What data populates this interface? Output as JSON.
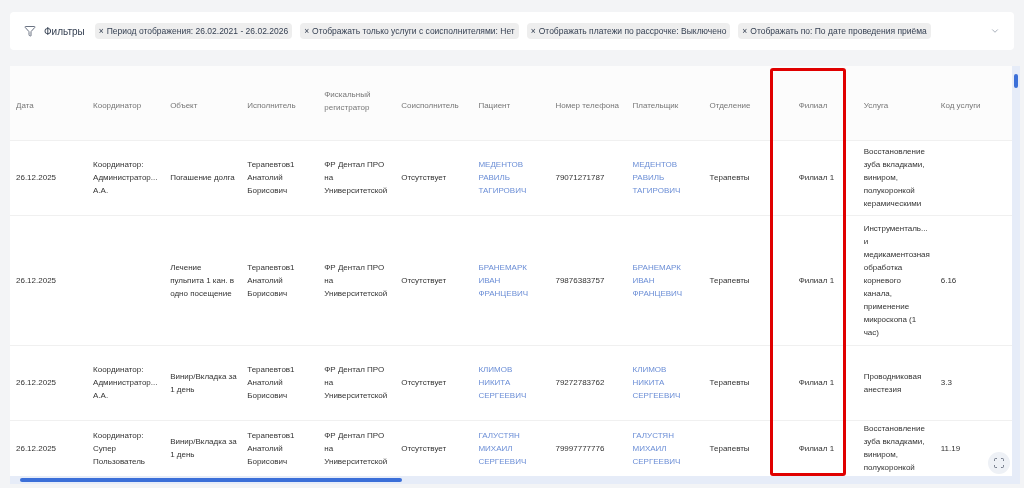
{
  "filters": {
    "label": "Фильтры",
    "tags": [
      {
        "remove": "×",
        "text": "Период отображения: 26.02.2021 - 26.02.2026"
      },
      {
        "remove": "×",
        "text": "Отображать только услуги с соисполнителями: Нет"
      },
      {
        "remove": "×",
        "text": "Отображать платежи по рассрочке: Выключено"
      },
      {
        "remove": "×",
        "text": "Отображать по: По дате проведения приёма"
      }
    ]
  },
  "table": {
    "columns": [
      {
        "label": "Дата",
        "kind": "text",
        "highlighted": false
      },
      {
        "label": "Координатор",
        "kind": "text",
        "highlighted": false
      },
      {
        "label": "Объект",
        "kind": "text",
        "highlighted": false
      },
      {
        "label": "Исполнитель",
        "kind": "text",
        "highlighted": false
      },
      {
        "label": "Фискальный регистратор",
        "kind": "text",
        "highlighted": false
      },
      {
        "label": "Соисполнитель",
        "kind": "text",
        "highlighted": false
      },
      {
        "label": "Пациент",
        "kind": "link",
        "highlighted": false
      },
      {
        "label": "Номер телефона",
        "kind": "text",
        "highlighted": false
      },
      {
        "label": "Плательщик",
        "kind": "link",
        "highlighted": false
      },
      {
        "label": "Отделение",
        "kind": "text",
        "highlighted": false
      },
      {
        "label": "Филиал",
        "kind": "text",
        "highlighted": true
      },
      {
        "label": "Услуга",
        "kind": "text",
        "highlighted": false
      },
      {
        "label": "Код услуги",
        "kind": "text",
        "highlighted": false
      }
    ],
    "rows": [
      {
        "cells": [
          "26.12.2025",
          "Координатор: Администратор... А.А.",
          "Погашение долга",
          "Терапевтов1 Анатолий Борисович",
          "ФР Дентал ПРО на Университетской",
          "Отсутствует",
          "МЕДЕНТОВ РАВИЛЬ ТАГИРОВИЧ",
          "79071271787",
          "МЕДЕНТОВ РАВИЛЬ ТАГИРОВИЧ",
          "Терапевты",
          "Филиал 1",
          "Восстановление зуба вкладками, виниром, полукоронкой керамическими",
          ""
        ]
      },
      {
        "cells": [
          "26.12.2025",
          "",
          "Лечение пульпита 1 кан. в одно посещение",
          "Терапевтов1 Анатолий Борисович",
          "ФР Дентал ПРО на Университетской",
          "Отсутствует",
          "БРАНЕМАРК ИВАН ФРАНЦЕВИЧ",
          "79876383757",
          "БРАНЕМАРК ИВАН ФРАНЦЕВИЧ",
          "Терапевты",
          "Филиал 1",
          "Инструменталь... и медикаментозная обработка корневого канала, применение микроскопа (1 час)",
          "6.16"
        ]
      },
      {
        "cells": [
          "26.12.2025",
          "Координатор: Администратор... А.А.",
          "Винир/Вкладка за 1 день",
          "Терапевтов1 Анатолий Борисович",
          "ФР Дентал ПРО на Университетской",
          "Отсутствует",
          "КЛИМОВ НИКИТА СЕРГЕЕВИЧ",
          "79272783762",
          "КЛИМОВ НИКИТА СЕРГЕЕВИЧ",
          "Терапевты",
          "Филиал 1",
          "Проводниковая анестезия",
          "3.3"
        ]
      },
      {
        "cells": [
          "26.12.2025",
          "Координатор: Супер Пользователь",
          "Винир/Вкладка за 1 день",
          "Терапевтов1 Анатолий Борисович",
          "ФР Дентал ПРО на Университетской",
          "Отсутствует",
          "ГАЛУСТЯН МИХАИЛ СЕРГЕЕВИЧ",
          "79997777776",
          "ГАЛУСТЯН МИХАИЛ СЕРГЕЕВИЧ",
          "Терапевты",
          "Филиал 1",
          "Восстановление зуба вкладками, виниром, полукоронкой",
          "11.19"
        ]
      }
    ]
  }
}
